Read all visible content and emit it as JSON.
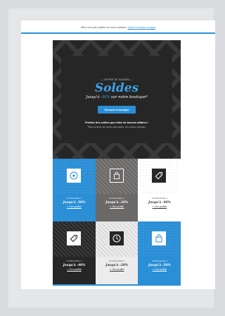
{
  "preheader": {
    "text": "Offre n'est pas valable sur bons cadeaux.",
    "link": "Ouvrir la version en ligne"
  },
  "hero": {
    "kicker": "— OFFRE DE SAISON —",
    "title": "Soldes",
    "subtitle_prefix": "Jusqu'à ",
    "subtitle_pct": "-50%",
    "subtitle_suffix": " sur notre boutique*",
    "cta": "Découvrir la boutique",
    "tagline": "Profitez des soldes pour faire de bonnes affaires !",
    "tagline_sub": "*Dans la limite des stocks disponibles, hors articles signalés."
  },
  "tiles": [
    {
      "category": "CATÉGORIE 1",
      "discount": "Jusqu'à -50%",
      "link": "» J'en profite",
      "icon": "target-icon",
      "theme": "blue"
    },
    {
      "category": "CATÉGORIE 2",
      "discount": "Jusqu'à -30%",
      "link": "» J'en profite",
      "icon": "bag-icon",
      "theme": "grey"
    },
    {
      "category": "CATÉGORIE 3",
      "discount": "Jusqu'à -40%",
      "link": "» J'en profite",
      "icon": "tag-icon",
      "theme": "white"
    },
    {
      "category": "CATÉGORIE 4",
      "discount": "Jusqu'à -40%",
      "link": "» J'en profite",
      "icon": "tag-icon",
      "theme": "dark"
    },
    {
      "category": "CATÉGORIE 5",
      "discount": "Jusqu'à -20%",
      "link": "» J'en profite",
      "icon": "clock-icon",
      "theme": "light"
    },
    {
      "category": "CATÉGORIE 6",
      "discount": "Jusqu'à -50%",
      "link": "» J'en profite",
      "icon": "bag-icon",
      "theme": "blue"
    }
  ],
  "colors": {
    "accent": "#2b8fd6",
    "hero_bg": "#262626",
    "tile_blue": "#2b8fd6",
    "tile_grey": "#6b6868",
    "tile_dark": "#262626",
    "tile_light": "#ececec"
  }
}
